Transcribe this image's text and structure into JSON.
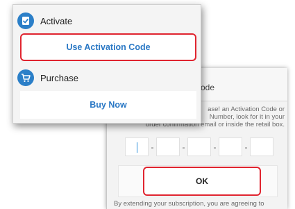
{
  "activation_dialog": {
    "title_fragment": "ode",
    "message_lines": [
      "ase! an Activation Code or",
      "Number, look for it in your",
      "order confirmation email or inside the retail box."
    ],
    "code_separator": "-",
    "ok_label": "OK",
    "footer_text": "By extending your subscription, you are agreeing to"
  },
  "menu": {
    "activate": {
      "heading": "Activate",
      "icon": "badge-check-icon",
      "button_label": "Use Activation Code"
    },
    "purchase": {
      "heading": "Purchase",
      "icon": "cart-icon",
      "button_label": "Buy Now"
    }
  },
  "colors": {
    "accent_blue": "#2b7fc8",
    "link_blue": "#2a78c5",
    "highlight_red": "#e0242f"
  }
}
